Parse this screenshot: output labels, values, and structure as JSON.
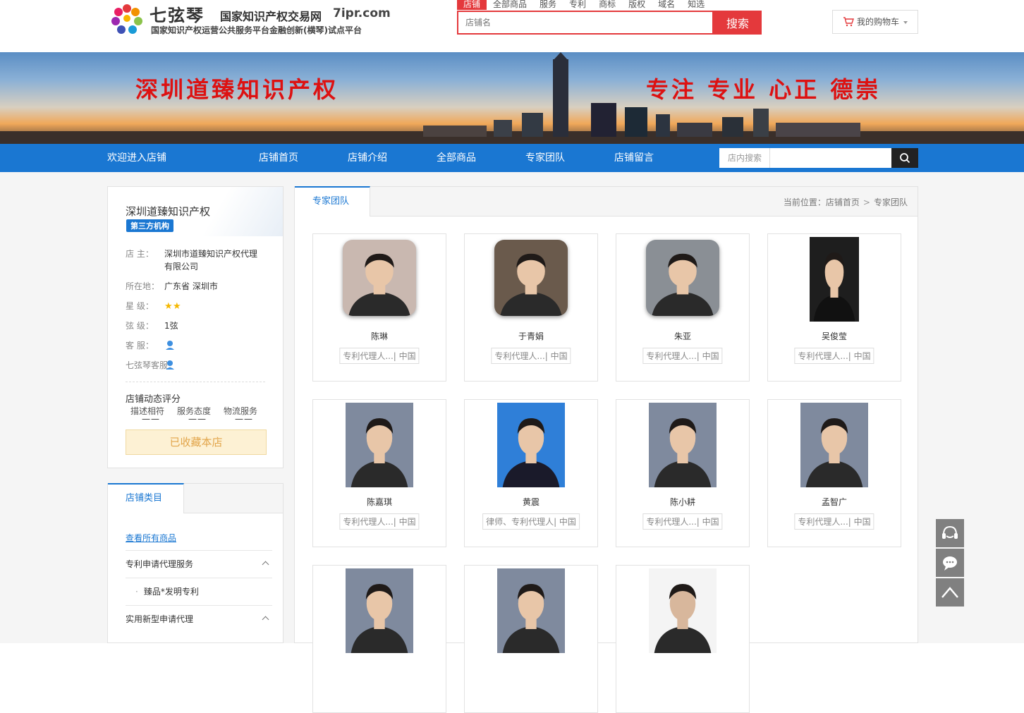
{
  "header": {
    "brand": "七弦琴",
    "site_name": "国家知识产权交易网",
    "domain": "7ipr.com",
    "subtitle": "国家知识产权运营公共服务平台金融创新(横琴)试点平台",
    "search_tabs": [
      "店铺",
      "全部商品",
      "服务",
      "专利",
      "商标",
      "版权",
      "域名",
      "知选"
    ],
    "search_placeholder": "店铺名",
    "search_button": "搜索",
    "cart_label": "我的购物车"
  },
  "banner": {
    "left_text": "深圳道臻知识产权",
    "right_text": "专注 专业 心正 德崇"
  },
  "nav": {
    "welcome": "欢迎进入店铺",
    "items": [
      "店铺首页",
      "店铺介绍",
      "全部商品",
      "专家团队",
      "店铺留言"
    ],
    "search_label": "店内搜索"
  },
  "shop": {
    "name": "深圳道臻知识产权",
    "badge": "第三方机构",
    "owner_label": "店 主：",
    "owner": "深圳市道臻知识产权代理有限公司",
    "location_label": "所在地：",
    "location": "广东省 深圳市",
    "stars_label": "星 级：",
    "stars": 2,
    "xian_label": "弦 级：",
    "xian": "1弦",
    "service_label": "客 服：",
    "qxq_service_label": "七弦琴客服：",
    "rating_title": "店铺动态评分",
    "rating_cols": [
      "描述相符",
      "服务态度",
      "物流服务"
    ],
    "rating_values": [
      "——",
      "——",
      "——"
    ],
    "favorite_button": "已收藏本店"
  },
  "categories": {
    "tab": "店铺类目",
    "view_all": "查看所有商品",
    "items": [
      {
        "label": "专利申请代理服务",
        "type": "group"
      },
      {
        "label": "臻品*发明专利",
        "type": "sub"
      },
      {
        "label": "实用新型申请代理",
        "type": "group"
      }
    ]
  },
  "main": {
    "tab": "专家团队",
    "breadcrumb_prefix": "当前位置：",
    "breadcrumb": [
      "店铺首页",
      "专家团队"
    ],
    "experts": [
      {
        "name": "陈琳",
        "tag": "专利代理人...| 中国",
        "photo_bg": "#c9b8b0",
        "style": "rounded"
      },
      {
        "name": "于青娟",
        "tag": "专利代理人...| 中国",
        "photo_bg": "#6a5a4c",
        "style": "rounded"
      },
      {
        "name": "朱亚",
        "tag": "专利代理人...| 中国",
        "photo_bg": "#8a8f95",
        "style": "rounded"
      },
      {
        "name": "吴俊莹",
        "tag": "专利代理人...| 中国",
        "photo_bg": "#1e1e1e",
        "style": "tall"
      },
      {
        "name": "陈嘉琪",
        "tag": "专利代理人...| 中国",
        "photo_bg": "#7f8a9e",
        "style": "box"
      },
      {
        "name": "黄震",
        "tag": "律师、专利代理人| 中国",
        "photo_bg": "#2f7fd8",
        "style": "box"
      },
      {
        "name": "陈小耕",
        "tag": "专利代理人...| 中国",
        "photo_bg": "#7f8a9e",
        "style": "box"
      },
      {
        "name": "孟智广",
        "tag": "专利代理人...| 中国",
        "photo_bg": "#7f8a9e",
        "style": "box"
      },
      {
        "name": "",
        "tag": "",
        "photo_bg": "#7f8a9e",
        "style": "box"
      },
      {
        "name": "",
        "tag": "",
        "photo_bg": "#7f8a9e",
        "style": "box"
      },
      {
        "name": "",
        "tag": "",
        "photo_bg": "#f4f4f4",
        "style": "box"
      }
    ]
  },
  "colors": {
    "brand_red": "#e4393c",
    "nav_blue": "#1a77d2",
    "star_gold": "#f5b800"
  }
}
